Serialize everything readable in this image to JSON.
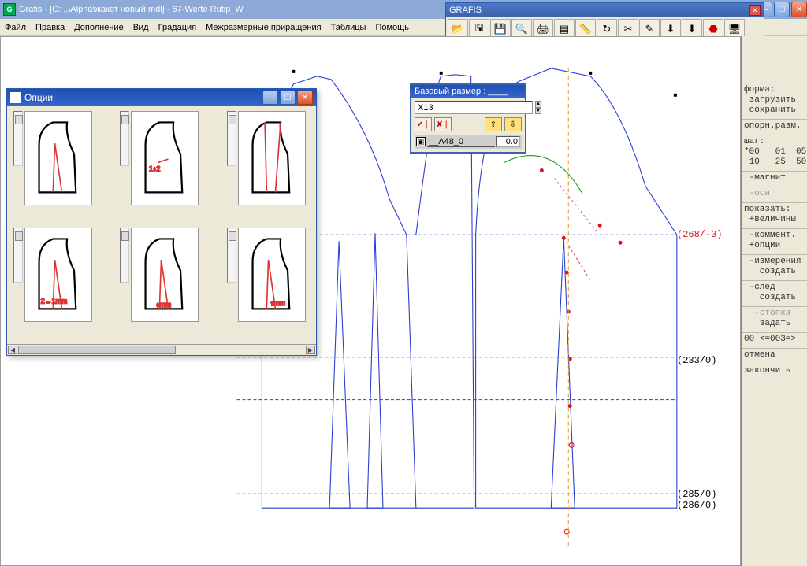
{
  "title": "Grafis - [C: ..\\Alpha\\жакет новый.mdl] - 67-Werte Rutip_W",
  "menu": [
    "Файл",
    "Правка",
    "Дополнение",
    "Вид",
    "Градация",
    "Межразмерные приращения",
    "Таблицы",
    "Помощь"
  ],
  "toolbar": {
    "title": "GRAFIS",
    "icons": [
      "open-icon",
      "save-icon",
      "disk-icon",
      "zoom-icon",
      "print-icon",
      "stack-icon",
      "ruler-icon",
      "refresh-icon",
      "scissors-icon",
      "note-icon",
      "down1-icon",
      "down2-icon",
      "stop-icon",
      "monitor-icon"
    ]
  },
  "options_window": {
    "title": "Опции"
  },
  "base_size": {
    "title": "Базовый размер : ____",
    "size_value": "X13",
    "param_name": "__A48_0",
    "param_value": "0.0"
  },
  "right_panel": {
    "forma": "форма:",
    "load": " загрузить",
    "save": " сохранить",
    "oporn": "опорн.разм.",
    "shag": "шаг:",
    "row1": "*00   01  05",
    "row2": " 10   25  50",
    "magnit": " -магнит",
    "osi": " -оси",
    "pokazat": "показать:",
    "velichiny": " +величины",
    "komm": " -коммент.",
    "opcii": " +опции",
    "izmer": " -измерения",
    "sozdat1": "   создать",
    "sled": " -след",
    "sozdat2": "   создать",
    "stopka": "  -стопка",
    "zadat": "   задать",
    "navrow": "00 <=003=>",
    "otmena": "отмена",
    "zakonchit": "закончить"
  },
  "canvas_labels": {
    "a": "(268/-3)",
    "b": "(233/0)",
    "c": "(285/0)",
    "d": "(286/0)"
  }
}
